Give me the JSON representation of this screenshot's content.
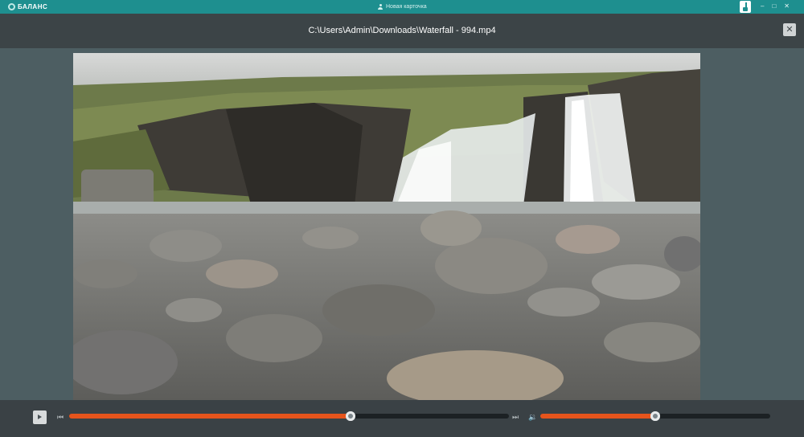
{
  "app": {
    "brand": "БАЛАНС",
    "tab_title": "Новая карточка",
    "window_controls": {
      "minimize": "–",
      "maximize": "□",
      "close": "✕"
    }
  },
  "player": {
    "file_path": "C:\\Users\\Admin\\Downloads\\Waterfall - 994.mp4",
    "close_label": "✕",
    "progress_fraction": 0.64,
    "volume_fraction": 0.5,
    "colors": {
      "accent": "#e5541c",
      "titlebar": "#1e8f8f",
      "header": "#3c4447",
      "backdrop": "#4d5e62"
    }
  },
  "icons": [
    "logo-icon",
    "person-icon",
    "app-icon",
    "play-icon",
    "previous-icon",
    "next-icon",
    "volume-icon",
    "close-icon"
  ]
}
